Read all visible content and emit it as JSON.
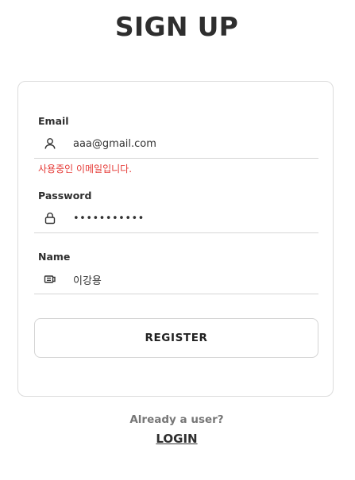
{
  "page": {
    "title": "SIGN UP"
  },
  "form": {
    "email": {
      "label": "Email",
      "value": "aaa@gmail.com",
      "icon": "person-icon",
      "error": "사용중인 이메일입니다."
    },
    "password": {
      "label": "Password",
      "value": "•••••••••••",
      "icon": "lock-icon"
    },
    "name": {
      "label": "Name",
      "value": "이강용",
      "icon": "badge-icon"
    },
    "register_label": "REGISTER"
  },
  "footer": {
    "prompt": "Already a user?",
    "login_label": "LOGIN"
  },
  "colors": {
    "error": "#e53935",
    "border": "#d6d6d6",
    "text": "#2f2f2f"
  }
}
